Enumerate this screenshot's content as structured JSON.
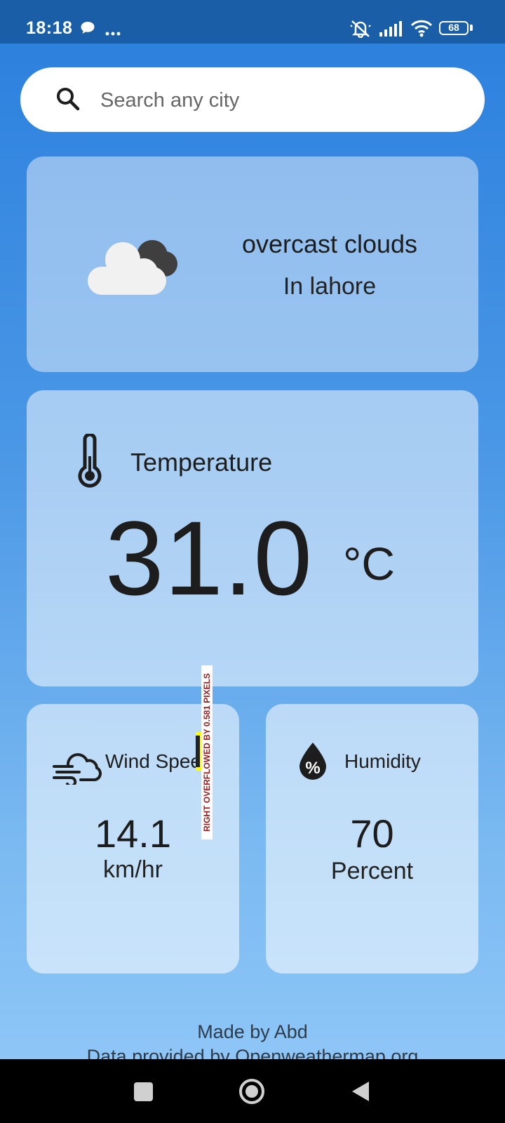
{
  "status_bar": {
    "time": "18:18",
    "battery": "68",
    "icons": [
      "chat-bubble-icon",
      "more-dots-icon",
      "mute-icon",
      "signal-icon",
      "wifi-icon",
      "battery-icon"
    ]
  },
  "search": {
    "placeholder": "Search any city",
    "value": ""
  },
  "condition": {
    "icon": "cloud-icon",
    "description": "overcast clouds",
    "location": "In lahore"
  },
  "temperature": {
    "icon": "thermometer-icon",
    "label": "Temperature",
    "value": "31.0",
    "unit": "°C"
  },
  "wind": {
    "icon": "wind-icon",
    "label": "Wind Speed",
    "value": "14.1",
    "unit": "km/hr",
    "overflow_warning": "RIGHT OVERFLOWED BY 0.581 PIXELS"
  },
  "humidity": {
    "icon": "humidity-drop-icon",
    "label": "Humidity",
    "value": "70",
    "unit": "Percent"
  },
  "footer": {
    "credit": "Made by Abd",
    "data_source": "Data provided by Openweathermap.org"
  },
  "colors": {
    "status_bar": "#1a5ea7",
    "background_top": "#2a7fdd",
    "background_bottom": "#8ec6f7",
    "overflow_warning_text": "#9b1b1b"
  }
}
